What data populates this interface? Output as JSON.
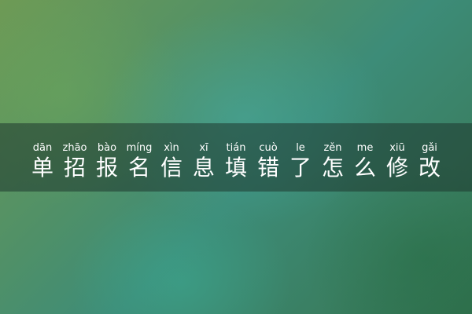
{
  "title": {
    "characters": [
      {
        "pinyin": "dān",
        "hanzi": "单"
      },
      {
        "pinyin": "zhāo",
        "hanzi": "招"
      },
      {
        "pinyin": "bào",
        "hanzi": "报"
      },
      {
        "pinyin": "míng",
        "hanzi": "名"
      },
      {
        "pinyin": "xìn",
        "hanzi": "信"
      },
      {
        "pinyin": "xī",
        "hanzi": "息"
      },
      {
        "pinyin": "tián",
        "hanzi": "填"
      },
      {
        "pinyin": "cuò",
        "hanzi": "错"
      },
      {
        "pinyin": "le",
        "hanzi": "了"
      },
      {
        "pinyin": "zěn",
        "hanzi": "怎"
      },
      {
        "pinyin": "me",
        "hanzi": "么"
      },
      {
        "pinyin": "xiū",
        "hanzi": "修"
      },
      {
        "pinyin": "gǎi",
        "hanzi": "改"
      }
    ]
  },
  "colors": {
    "background_gradient": [
      "#6e9a55",
      "#3d8c78",
      "#2f6f4c"
    ],
    "banner": "#1e372d",
    "text": "#ffffff"
  }
}
